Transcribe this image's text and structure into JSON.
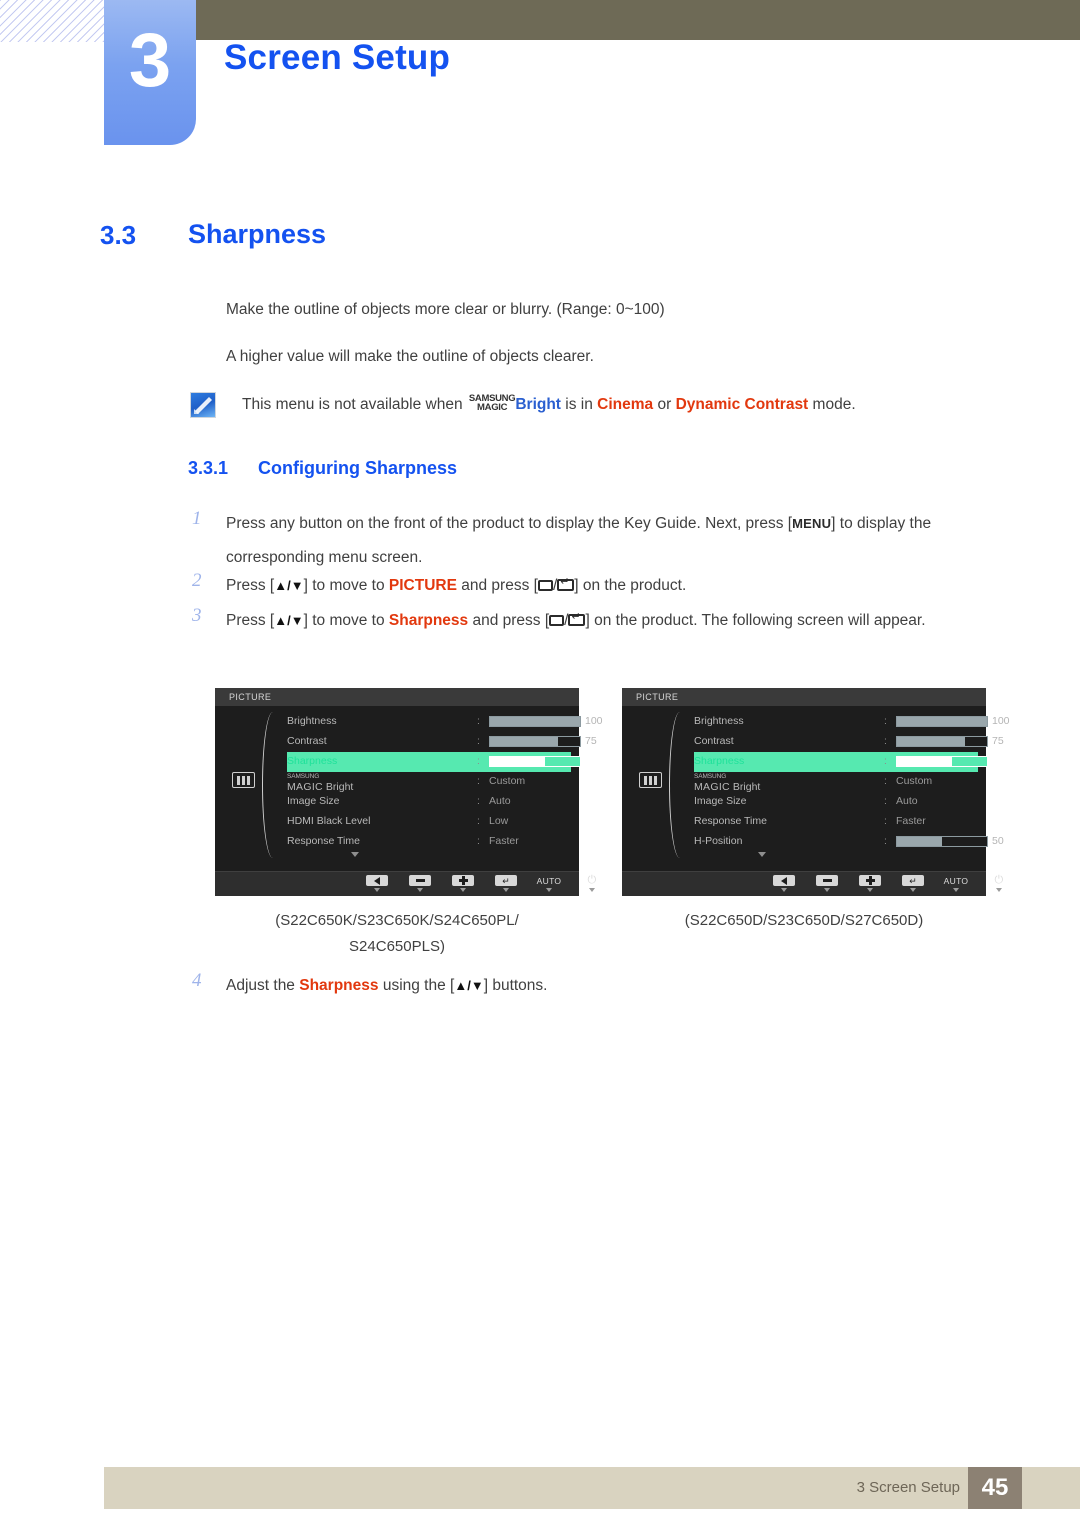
{
  "header": {
    "chapter_number": "3",
    "chapter_title": "Screen Setup"
  },
  "section": {
    "number": "3.3",
    "title": "Sharpness",
    "paragraph_1": "Make the outline of objects more clear or blurry. (Range: 0~100)",
    "paragraph_2": "A higher value will make the outline of objects clearer."
  },
  "note": {
    "icon": "note-pen-icon",
    "text_before": "This menu is not available when ",
    "magic_top": "SAMSUNG",
    "magic_bottom": "MAGIC",
    "bright": "Bright",
    "text_mid_1": " is in ",
    "mode_1": "Cinema",
    "text_mid_2": " or ",
    "mode_2": "Dynamic Contrast",
    "text_after": " mode."
  },
  "subsection": {
    "number": "3.3.1",
    "title": "Configuring Sharpness"
  },
  "steps": [
    {
      "number": "1",
      "parts": [
        {
          "t": "Press any button on the front of the product to display the Key Guide. Next, press ["
        },
        {
          "t": "MENU",
          "style": "kbd"
        },
        {
          "t": "] to display the corresponding menu screen."
        }
      ]
    },
    {
      "number": "2",
      "parts": [
        {
          "t": "Press ["
        },
        {
          "t": "ARROWS",
          "style": "arrows"
        },
        {
          "t": "] to move to "
        },
        {
          "t": "PICTURE",
          "style": "red"
        },
        {
          "t": " and press ["
        },
        {
          "t": "GLYPHS",
          "style": "glyphs"
        },
        {
          "t": "] on the product."
        }
      ]
    },
    {
      "number": "3",
      "parts": [
        {
          "t": "Press ["
        },
        {
          "t": "ARROWS",
          "style": "arrows"
        },
        {
          "t": "] to move to "
        },
        {
          "t": "Sharpness",
          "style": "red"
        },
        {
          "t": " and press ["
        },
        {
          "t": "GLYPHS",
          "style": "glyphs"
        },
        {
          "t": "] on the product. The following screen will appear."
        }
      ]
    },
    {
      "number": "4",
      "parts": [
        {
          "t": "Adjust the "
        },
        {
          "t": "Sharpness",
          "style": "red"
        },
        {
          "t": " using the ["
        },
        {
          "t": "ARROWS",
          "style": "arrows"
        },
        {
          "t": "] buttons."
        }
      ]
    }
  ],
  "osd_left": {
    "title": "PICTURE",
    "side_icon": "picture-bars-icon",
    "rows": [
      {
        "label": "Brightness",
        "type": "bar",
        "value": "100",
        "fill_pct": 100,
        "selected": false
      },
      {
        "label": "Contrast",
        "type": "bar",
        "value": "75",
        "fill_pct": 75,
        "selected": false
      },
      {
        "label": "Sharpness",
        "type": "bar",
        "value": "60",
        "fill_pct": 60,
        "selected": true
      },
      {
        "label": "MagicBright",
        "type": "magic",
        "value": "Custom",
        "selected": false
      },
      {
        "label": "Image Size",
        "type": "text",
        "value": "Auto",
        "selected": false
      },
      {
        "label": "HDMI Black Level",
        "type": "text",
        "value": "Low",
        "selected": false
      },
      {
        "label": "Response Time",
        "type": "text",
        "value": "Faster",
        "selected": false
      }
    ],
    "footer_buttons": [
      {
        "icon": "left-arrow-icon",
        "label": ""
      },
      {
        "icon": "minus-icon",
        "label": ""
      },
      {
        "icon": "plus-icon",
        "label": ""
      },
      {
        "icon": "enter-icon",
        "label": ""
      },
      {
        "icon": "auto-text",
        "label": "AUTO"
      },
      {
        "icon": "power-icon",
        "label": ""
      }
    ]
  },
  "osd_right": {
    "title": "PICTURE",
    "side_icon": "picture-bars-icon",
    "rows": [
      {
        "label": "Brightness",
        "type": "bar",
        "value": "100",
        "fill_pct": 100,
        "selected": false
      },
      {
        "label": "Contrast",
        "type": "bar",
        "value": "75",
        "fill_pct": 75,
        "selected": false
      },
      {
        "label": "Sharpness",
        "type": "bar",
        "value": "60",
        "fill_pct": 60,
        "selected": true
      },
      {
        "label": "MagicBright",
        "type": "magic",
        "value": "Custom",
        "selected": false
      },
      {
        "label": "Image Size",
        "type": "text",
        "value": "Auto",
        "selected": false
      },
      {
        "label": "Response Time",
        "type": "text",
        "value": "Faster",
        "selected": false
      },
      {
        "label": "H-Position",
        "type": "bar",
        "value": "50",
        "fill_pct": 50,
        "selected": false
      }
    ],
    "footer_buttons": [
      {
        "icon": "left-arrow-icon",
        "label": ""
      },
      {
        "icon": "minus-icon",
        "label": ""
      },
      {
        "icon": "plus-icon",
        "label": ""
      },
      {
        "icon": "enter-icon",
        "label": ""
      },
      {
        "icon": "auto-text",
        "label": "AUTO"
      },
      {
        "icon": "power-icon",
        "label": ""
      }
    ]
  },
  "captions": {
    "left_line_1": "(S22C650K/S23C650K/S24C650PL/",
    "left_line_2": "S24C650PLS)",
    "right": "(S22C650D/S23C650D/S27C650D)"
  },
  "footer": {
    "text": "3 Screen Setup",
    "page": "45"
  },
  "colors": {
    "heading_blue": "#1452f0",
    "accent_red": "#e2380e",
    "magic_blue": "#2a5fd0",
    "osd_highlight": "#56e9b0",
    "osd_bg": "#1d1d1d",
    "header_olive": "#6e6a56",
    "footer_band": "#d9d3c0",
    "footer_page": "#8c8173"
  }
}
